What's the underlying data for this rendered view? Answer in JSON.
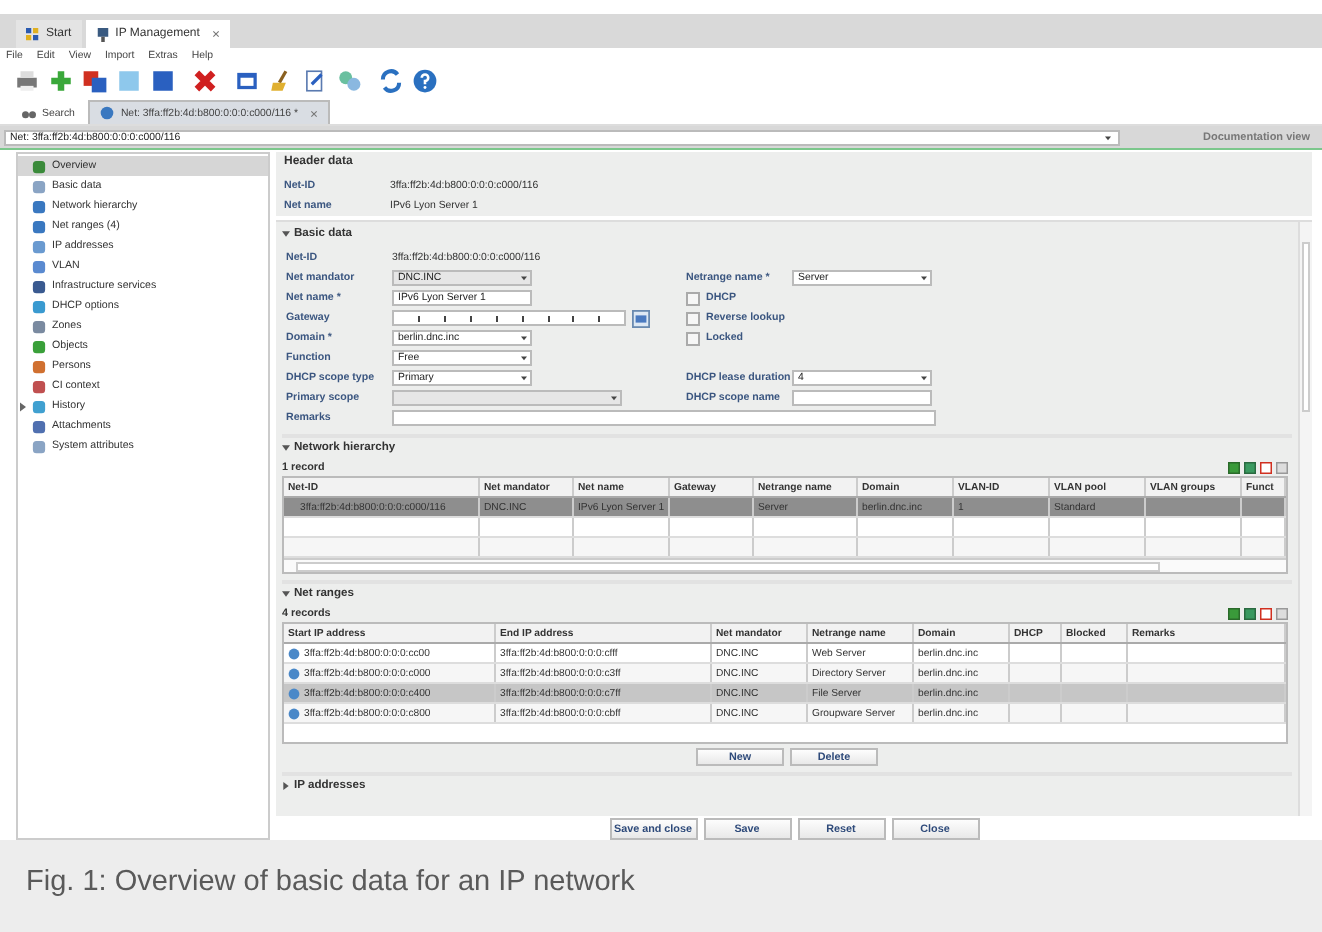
{
  "app_tabs": [
    {
      "label": "Start",
      "selected": false,
      "closable": false
    },
    {
      "label": "IP Management",
      "selected": true,
      "closable": true
    }
  ],
  "menu": [
    "File",
    "Edit",
    "View",
    "Import",
    "Extras",
    "Help"
  ],
  "doc_tabs": [
    {
      "label": "Search",
      "selected": false,
      "closable": false
    },
    {
      "label": "Net: 3ffa:ff2b:4d:b800:0:0:0:c000/116 *",
      "selected": true,
      "closable": true
    }
  ],
  "address": "Net: 3ffa:ff2b:4d:b800:0:0:0:c000/116",
  "documentation_view": "Documentation view",
  "sidebar": [
    {
      "label": "Overview",
      "selected": true,
      "kind": "item"
    },
    {
      "label": "Basic data",
      "selected": false,
      "kind": "item"
    },
    {
      "label": "Network hierarchy",
      "selected": false,
      "kind": "item"
    },
    {
      "label": "Net ranges (4)",
      "selected": false,
      "kind": "item"
    },
    {
      "label": "IP addresses",
      "selected": false,
      "kind": "item"
    },
    {
      "label": "VLAN",
      "selected": false,
      "kind": "item"
    },
    {
      "label": "Infrastructure services",
      "selected": false,
      "kind": "item"
    },
    {
      "label": "DHCP options",
      "selected": false,
      "kind": "item"
    },
    {
      "label": "Zones",
      "selected": false,
      "kind": "item"
    },
    {
      "label": "Objects",
      "selected": false,
      "kind": "item"
    },
    {
      "label": "Persons",
      "selected": false,
      "kind": "item"
    },
    {
      "label": "CI context",
      "selected": false,
      "kind": "item"
    },
    {
      "label": "History",
      "selected": false,
      "kind": "group"
    },
    {
      "label": "Attachments",
      "selected": false,
      "kind": "item"
    },
    {
      "label": "System attributes",
      "selected": false,
      "kind": "item"
    }
  ],
  "header_data": {
    "title": "Header data",
    "fields": [
      {
        "label": "Net-ID",
        "value": "3ffa:ff2b:4d:b800:0:0:0:c000/116"
      },
      {
        "label": "Net name",
        "value": "IPv6 Lyon Server 1"
      }
    ]
  },
  "basic_data": {
    "title": "Basic data",
    "expanded": true,
    "rows": [
      [
        {
          "label": "Net-ID",
          "kind": "text",
          "value": "3ffa:ff2b:4d:b800:0:0:0:c000/116"
        }
      ],
      [
        {
          "label": "Net mandator",
          "kind": "select",
          "value": "DNC.INC",
          "disabled": true
        },
        {
          "label": "Netrange name *",
          "kind": "select",
          "value": "Server",
          "disabled": false
        }
      ],
      [
        {
          "label": "Net name *",
          "kind": "input",
          "value": "IPv6 Lyon Server 1",
          "disabled": false
        },
        {
          "label": "DHCP",
          "kind": "checkbox",
          "checked": false
        }
      ],
      [
        {
          "label": "Gateway",
          "kind": "ipv6"
        },
        {
          "label": "Reverse lookup",
          "kind": "checkbox",
          "checked": false
        }
      ],
      [
        {
          "label": "Domain *",
          "kind": "select",
          "value": "berlin.dnc.inc",
          "disabled": false
        },
        {
          "label": "Locked",
          "kind": "checkbox",
          "checked": false
        }
      ],
      [
        {
          "label": "Function",
          "kind": "select",
          "value": "Free",
          "disabled": false
        }
      ],
      [
        {
          "label": "DHCP scope type",
          "kind": "select",
          "value": "Primary",
          "disabled": false
        },
        {
          "label": "DHCP lease duration",
          "kind": "select",
          "value": "4",
          "disabled": false
        }
      ],
      [
        {
          "label": "Primary scope",
          "kind": "select",
          "disabled": true
        },
        {
          "label": "DHCP scope name",
          "kind": "input",
          "disabled": false
        }
      ],
      [
        {
          "label": "Remarks",
          "kind": "input",
          "disabled": false
        }
      ]
    ]
  },
  "network_hierarchy": {
    "title": "Network hierarchy",
    "expanded": true,
    "count": "1 record",
    "columns": [
      "Net-ID",
      "Net mandator",
      "Net name",
      "Gateway",
      "Netrange name",
      "Domain",
      "VLAN-ID",
      "VLAN pool",
      "VLAN groups",
      "Funct"
    ],
    "rows": [
      {
        "selected": true,
        "cells": [
          "3ffa:ff2b:4d:b800:0:0:0:c000/116",
          "DNC.INC",
          "IPv6 Lyon Server 1",
          "",
          "Server",
          "berlin.dnc.inc",
          "1",
          "Standard",
          "",
          ""
        ]
      }
    ]
  },
  "net_ranges": {
    "title": "Net ranges",
    "expanded": true,
    "count": "4 records",
    "columns": [
      "Start IP address",
      "End IP address",
      "Net mandator",
      "Netrange name",
      "Domain",
      "DHCP",
      "Blocked",
      "Remarks"
    ],
    "rows": [
      {
        "selected": false,
        "cells": [
          "3ffa:ff2b:4d:b800:0:0:0:cc00",
          "3ffa:ff2b:4d:b800:0:0:0:cfff",
          "DNC.INC",
          "Web Server",
          "berlin.dnc.inc",
          "",
          "",
          ""
        ]
      },
      {
        "selected": false,
        "cells": [
          "3ffa:ff2b:4d:b800:0:0:0:c000",
          "3ffa:ff2b:4d:b800:0:0:0:c3ff",
          "DNC.INC",
          "Directory Server",
          "berlin.dnc.inc",
          "",
          "",
          ""
        ]
      },
      {
        "selected": true,
        "cells": [
          "3ffa:ff2b:4d:b800:0:0:0:c400",
          "3ffa:ff2b:4d:b800:0:0:0:c7ff",
          "DNC.INC",
          "File Server",
          "berlin.dnc.inc",
          "",
          "",
          ""
        ]
      },
      {
        "selected": false,
        "cells": [
          "3ffa:ff2b:4d:b800:0:0:0:c800",
          "3ffa:ff2b:4d:b800:0:0:0:cbff",
          "DNC.INC",
          "Groupware Server",
          "berlin.dnc.inc",
          "",
          "",
          ""
        ]
      }
    ],
    "buttons": [
      "New",
      "Delete"
    ]
  },
  "ip_addresses": {
    "title": "IP addresses",
    "expanded": false
  },
  "buttons": [
    "Save and close",
    "Save",
    "Reset",
    "Close"
  ],
  "caption": "Fig. 1: Overview of basic data for an IP network"
}
